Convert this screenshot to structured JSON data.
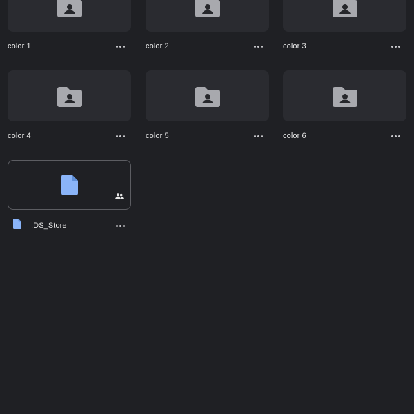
{
  "folders": [
    {
      "name": "color 1",
      "icon": "shared-folder-icon"
    },
    {
      "name": "color 2",
      "icon": "shared-folder-icon"
    },
    {
      "name": "color 3",
      "icon": "shared-folder-icon"
    },
    {
      "name": "color 4",
      "icon": "shared-folder-icon"
    },
    {
      "name": "color 5",
      "icon": "shared-folder-icon"
    },
    {
      "name": "color 6",
      "icon": "shared-folder-icon"
    }
  ],
  "files": [
    {
      "name": ".DS_Store",
      "icon": "document-icon",
      "badge": "shared-users-icon"
    }
  ],
  "colors": {
    "background": "#1f2024",
    "tile": "#2a2b30",
    "folder_icon": "#a8a9ae",
    "doc_icon": "#8ab4f8",
    "text": "#e8e8e8"
  }
}
